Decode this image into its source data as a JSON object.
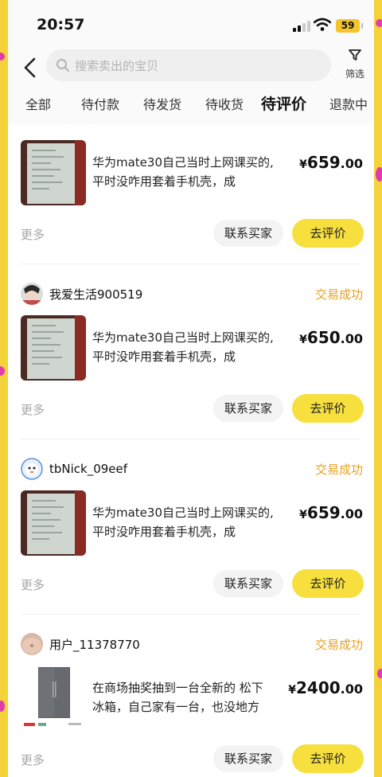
{
  "status_bar": {
    "time": "20:57",
    "battery": "59"
  },
  "search": {
    "placeholder": "搜索卖出的宝贝"
  },
  "filter": {
    "label": "筛选"
  },
  "tabs": [
    {
      "label": "全部"
    },
    {
      "label": "待付款"
    },
    {
      "label": "待发货"
    },
    {
      "label": "待收货"
    },
    {
      "label": "待评价",
      "active": true
    },
    {
      "label": "退款中"
    }
  ],
  "actions": {
    "more": "更多",
    "contact": "联系买家",
    "review": "去评价"
  },
  "orders": [
    {
      "buyer": "",
      "status": "",
      "desc_line1": "华为mate30自己当时上网课买的,",
      "desc_line2": "平时没咋用套着手机壳，成",
      "price_symbol": "¥",
      "price_int": "659",
      "price_dec": ".00"
    },
    {
      "buyer": "我爱生活900519",
      "status": "交易成功",
      "desc_line1": "华为mate30自己当时上网课买的,",
      "desc_line2": "平时没咋用套着手机壳，成",
      "price_symbol": "¥",
      "price_int": "650",
      "price_dec": ".00"
    },
    {
      "buyer": "tbNick_09eef",
      "status": "交易成功",
      "desc_line1": "华为mate30自己当时上网课买的,",
      "desc_line2": "平时没咋用套着手机壳，成",
      "price_symbol": "¥",
      "price_int": "659",
      "price_dec": ".00"
    },
    {
      "buyer": "用户_11378770",
      "status": "交易成功",
      "desc_line1": "在商场抽奖抽到一台全新的 松下",
      "desc_line2": "冰箱，自己家有一台，也没地方",
      "price_symbol": "¥",
      "price_int": "2400",
      "price_dec": ".00"
    }
  ],
  "colors": {
    "accent": "#f7df3e",
    "status": "#e6a020",
    "frame": "#f4d23a"
  }
}
